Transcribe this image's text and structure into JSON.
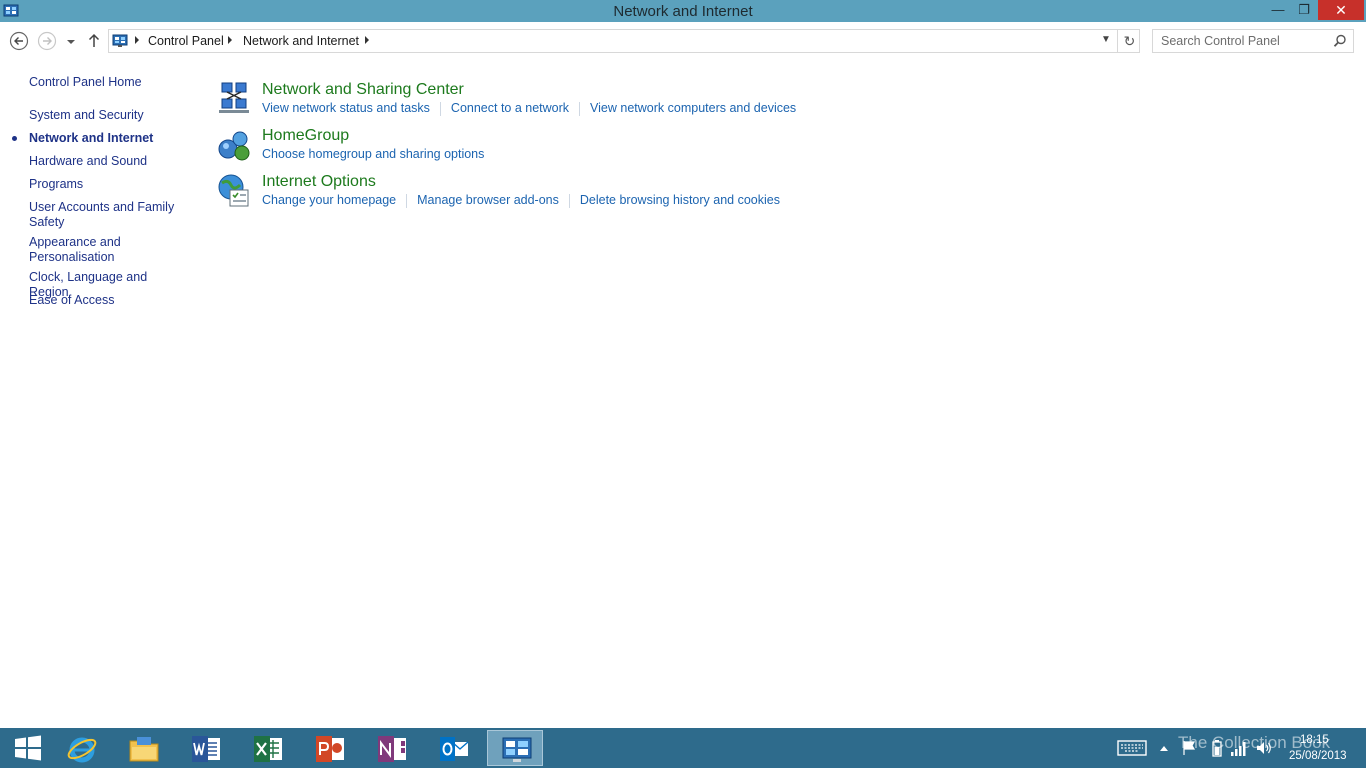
{
  "window": {
    "title": "Network and Internet",
    "minimize_glyph": "—",
    "maximize_glyph": "❐",
    "close_glyph": "✕"
  },
  "address": {
    "crumbs": [
      "Control Panel",
      "Network and Internet"
    ],
    "search_placeholder": "Search Control Panel"
  },
  "sidebar": {
    "home": "Control Panel Home",
    "items": [
      {
        "label": "System and Security",
        "active": false
      },
      {
        "label": "Network and Internet",
        "active": true
      },
      {
        "label": "Hardware and Sound",
        "active": false
      },
      {
        "label": "Programs",
        "active": false
      },
      {
        "label": "User Accounts and Family Safety",
        "active": false
      },
      {
        "label": "Appearance and Personalisation",
        "active": false
      },
      {
        "label": "Clock, Language and Region",
        "active": false
      },
      {
        "label": "Ease of Access",
        "active": false
      }
    ]
  },
  "categories": [
    {
      "title": "Network and Sharing Center",
      "icon": "network-sharing-icon",
      "links": [
        "View network status and tasks",
        "Connect to a network",
        "View network computers and devices"
      ]
    },
    {
      "title": "HomeGroup",
      "icon": "homegroup-icon",
      "links": [
        "Choose homegroup and sharing options"
      ]
    },
    {
      "title": "Internet Options",
      "icon": "internet-options-icon",
      "links": [
        "Change your homepage",
        "Manage browser add-ons",
        "Delete browsing history and cookies"
      ]
    }
  ],
  "taskbar": {
    "apps": [
      "start",
      "internet-explorer",
      "file-explorer",
      "word",
      "excel",
      "powerpoint",
      "onenote",
      "outlook",
      "control-panel"
    ],
    "watermark": "The Collection Book",
    "time": "18:15",
    "date": "25/08/2013"
  },
  "colors": {
    "titlebar": "#5ba1bd",
    "taskbar": "#2e6b8c",
    "link": "#1c64b0",
    "category_title": "#1d7a1d",
    "nav_text": "#1e3287",
    "close_button": "#c7302a"
  }
}
